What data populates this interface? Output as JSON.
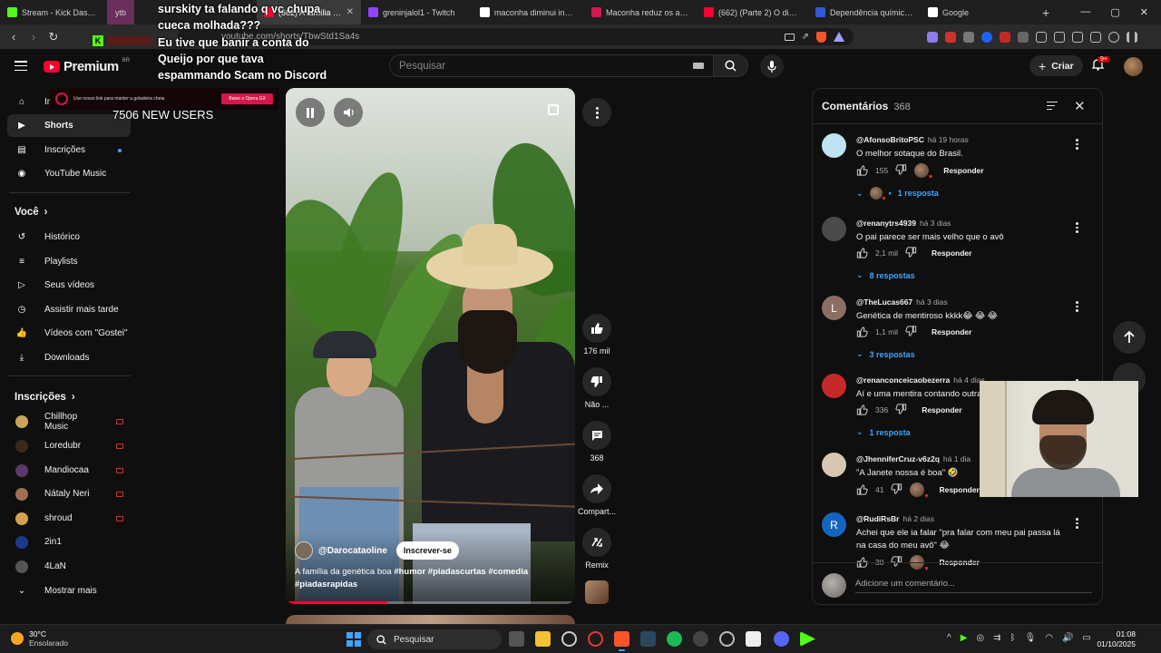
{
  "browser": {
    "tabs": [
      {
        "label": "Stream - Kick Dashboard",
        "favicon": "kick-icon",
        "color": "#53fc18"
      },
      {
        "label": "ytb",
        "favicon": "group-icon",
        "color": "#7a3e6a"
      },
      {
        "label": "Tubemate — YouTube Shorts",
        "favicon": "tubemate-icon",
        "color": "#ffffff"
      },
      {
        "label": "(662) A família da...",
        "favicon": "youtube-icon",
        "color": "#ff0033"
      },
      {
        "label": "greninjalol1 - Twitch",
        "favicon": "twitch-icon",
        "color": "#9146ff"
      },
      {
        "label": "maconha diminui inciden...",
        "favicon": "google-icon",
        "color": "#ffffff"
      },
      {
        "label": "Maconha reduz os aciden...",
        "favicon": "s-icon",
        "color": "#d3184a"
      },
      {
        "label": "(662) (Parte 2) O dia que...",
        "favicon": "youtube-icon",
        "color": "#ff0033"
      },
      {
        "label": "Dependência química: da...",
        "favicon": "mp-icon",
        "color": "#2f5bd3"
      },
      {
        "label": "Google",
        "favicon": "google-icon",
        "color": "#ffffff"
      }
    ],
    "url": "youtube.com/shorts/TbwStd1Sa4s",
    "new_tab": "+",
    "window": {
      "minimize": "—",
      "maximize": "▢",
      "close": "✕"
    }
  },
  "overlay": {
    "chat_lines": [
      "surskity ta falando q vc chupa",
      "cueca molhada???",
      "Eu tive que banir a conta do",
      "Queijo por que tava",
      "espammando Scam no Discord"
    ],
    "new_users": "7506 NEW USERS",
    "banner_text": "Use nosso link para manter a geladeira cheia",
    "banner_button": "Baixe o Opera GX"
  },
  "youtube": {
    "brand": "Premium",
    "country": "BR",
    "search_placeholder": "Pesquisar",
    "create_label": "Criar",
    "notifications_badge": "9+",
    "sidebar": {
      "main": [
        {
          "label": "Início",
          "icon": "home-icon"
        },
        {
          "label": "Shorts",
          "icon": "shorts-icon"
        },
        {
          "label": "Inscrições",
          "icon": "subscriptions-icon"
        },
        {
          "label": "YouTube Music",
          "icon": "music-icon"
        }
      ],
      "you_header": "Você",
      "you_items": [
        {
          "label": "Histórico",
          "icon": "history-icon"
        },
        {
          "label": "Playlists",
          "icon": "playlists-icon"
        },
        {
          "label": "Seus vídeos",
          "icon": "your-videos-icon"
        },
        {
          "label": "Assistir mais tarde",
          "icon": "watch-later-icon"
        },
        {
          "label": "Vídeos com \"Gostei\"",
          "icon": "liked-icon"
        },
        {
          "label": "Downloads",
          "icon": "download-icon"
        }
      ],
      "subs_header": "Inscrições",
      "subs": [
        {
          "label": "Chillhop Music",
          "color": "#c9a45a"
        },
        {
          "label": "Loredubr",
          "color": "#3a2a1a"
        },
        {
          "label": "Mandiocaa",
          "color": "#5a3a6a"
        },
        {
          "label": "Nátaly Neri",
          "color": "#a07050"
        },
        {
          "label": "shroud",
          "color": "#d2a050"
        },
        {
          "label": "2in1",
          "color": "#1a3a8a"
        },
        {
          "label": "4LaN",
          "color": "#555555"
        }
      ],
      "show_more": "Mostrar mais"
    },
    "short": {
      "channel": "@Darocataoline",
      "subscribe": "Inscrever-se",
      "title": "A família da genética boa ",
      "hashtags": "#humor #piadascurtas #comedia #piadasrapidas",
      "progress": 0.35,
      "actions": {
        "likes": "176 mil",
        "dislike": "Não ...",
        "comments": "368",
        "share": "Compart...",
        "remix": "Remix"
      }
    },
    "comments": {
      "title": "Comentários",
      "count": "368",
      "add_placeholder": "Adicione um comentário...",
      "items": [
        {
          "author": "@AfonsoBritoPSC",
          "time": "há 19 horas",
          "text": "O melhor sotaque do Brasil.",
          "likes": "155",
          "replies": "1 resposta",
          "avatar_color": "#bfe3f2",
          "avatar_letter": "",
          "heart": true
        },
        {
          "author": "@renanytrs4939",
          "time": "há 3 dias",
          "text": "O pai parece ser mais velho que o avô",
          "likes": "2,1 mil",
          "replies": "8 respostas",
          "avatar_color": "#4a4a4a",
          "avatar_letter": "",
          "heart": false
        },
        {
          "author": "@TheLucas667",
          "time": "há 3 dias",
          "text": "Genética de mentiroso kkkk😂 😂 😂",
          "likes": "1,1 mil",
          "replies": "3 respostas",
          "avatar_color": "#8d6e63",
          "avatar_letter": "L",
          "heart": false
        },
        {
          "author": "@renanconceicaobezerra",
          "time": "há 4 dias",
          "text": "Aí e uma mentira contando outra",
          "likes": "336",
          "replies": "1 resposta",
          "avatar_color": "#c62828",
          "avatar_letter": "",
          "heart": false
        },
        {
          "author": "@JhenniferCruz-v6z2q",
          "time": "há 1 dia",
          "text": "\"A Janete nossa é boa\" 🤣",
          "likes": "41",
          "replies": "",
          "avatar_color": "#d8c7b0",
          "avatar_letter": "",
          "heart": true
        },
        {
          "author": "@RudiRsBr",
          "time": "há 2 dias",
          "text": "Achei que ele ia falar \"pra falar com meu pai passa lá na casa do meu avô\" 😂",
          "likes": "30",
          "replies": "",
          "avatar_color": "#1565c0",
          "avatar_letter": "R",
          "heart": true
        }
      ],
      "reply_label": "Responder"
    }
  },
  "taskbar": {
    "weather_temp": "30°C",
    "weather_desc": "Ensolarado",
    "search": "Pesquisar",
    "time": "01:08",
    "date": "01/10/2025"
  }
}
